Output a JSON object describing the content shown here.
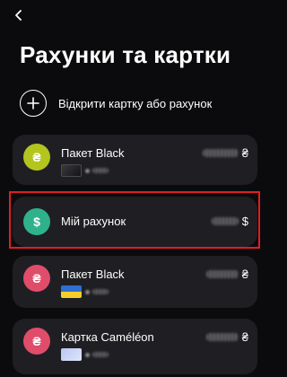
{
  "header": {
    "back_icon": "chevron-left-icon",
    "title": "Рахунки та картки"
  },
  "open_action": {
    "icon": "plus-icon",
    "label": "Відкрити картку або рахунок"
  },
  "accounts": [
    {
      "name": "Пакет Black",
      "currency": "₴",
      "avatar_symbol": "₴",
      "avatar_color": "#b3c51e",
      "card_thumb": "black-card",
      "selected": false
    },
    {
      "name": "Мій рахунок",
      "currency": "$",
      "avatar_symbol": "$",
      "avatar_color": "#2fb28b",
      "selected": true
    },
    {
      "name": "Пакет Black",
      "currency": "₴",
      "avatar_symbol": "₴",
      "avatar_color": "#df4d6a",
      "card_thumb": "ukraine-flag-card",
      "selected": false
    },
    {
      "name": "Картка Caméléon",
      "currency": "₴",
      "avatar_symbol": "₴",
      "avatar_color": "#df4d6a",
      "card_thumb": "chameleon-card",
      "selected": false
    }
  ],
  "colors": {
    "background": "#0b0b0d",
    "card_background": "#1f1f23",
    "highlight": "#e01e24"
  }
}
